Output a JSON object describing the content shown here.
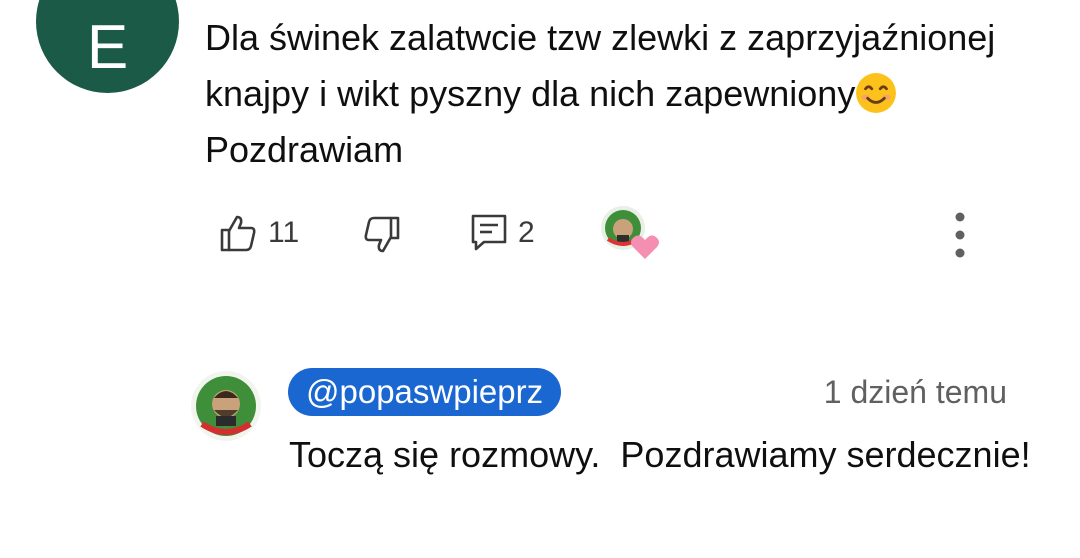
{
  "comment": {
    "avatar_letter": "E",
    "text_part1": "Dla świnek zalatwcie tzw zlewki z zaprzyjaźnionej knajpy i wikt pyszny dla nich zapewniony",
    "emoji": "smiling-face-icon",
    "text_part2": "Pozdrawiam",
    "likes": "11",
    "replies": "2"
  },
  "reply": {
    "handle": "@popaswpieprz",
    "time": "1 dzień temu",
    "text": "Toczą się rozmowy.  Pozdrawiamy serdecznie!"
  },
  "colors": {
    "avatar_bg": "#1b5a47",
    "handle_pill": "#1a67d2",
    "heart": "#f48fb1",
    "channel_logo_green": "#3f8f3a"
  }
}
